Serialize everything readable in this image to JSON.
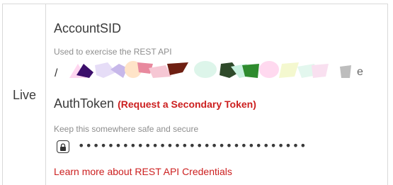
{
  "environment_label": "Live",
  "account_sid": {
    "title": "AccountSID",
    "description": "Used to exercise the REST API"
  },
  "auth_token": {
    "title": "AuthToken",
    "request_secondary_label": "(Request a Secondary Token)",
    "description": "Keep this somewhere safe and secure",
    "masked_value": "•••••••••••••••••••••••••••••••",
    "lock_icon": "lock-icon"
  },
  "learn_more_link": "Learn more about REST API Credentials",
  "colors": {
    "link_red": "#cc1f1f",
    "border": "#d9d9d9",
    "muted_text": "#8e8e8e"
  }
}
